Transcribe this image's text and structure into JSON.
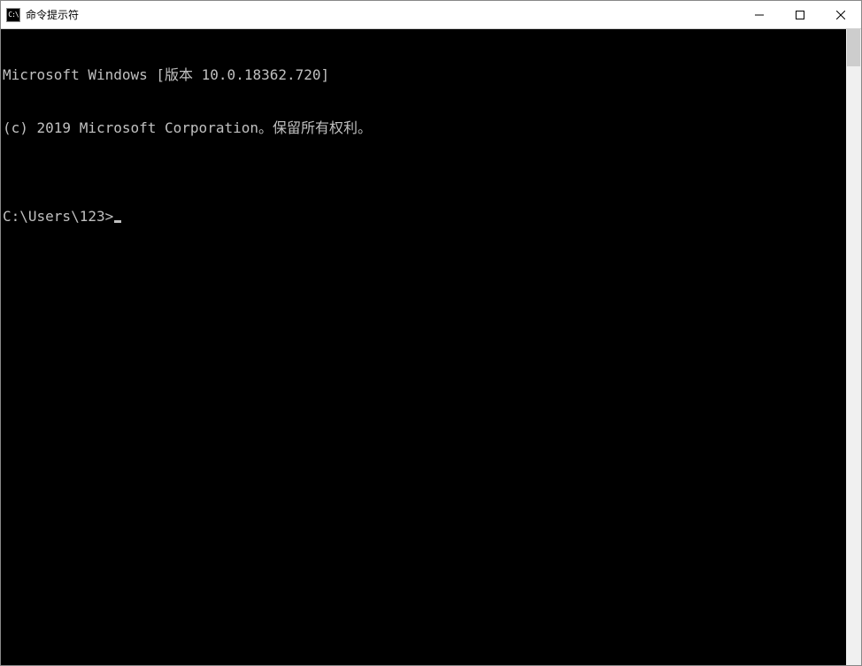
{
  "window": {
    "title": "命令提示符",
    "icon_label": "C:\\"
  },
  "console": {
    "line1": "Microsoft Windows [版本 10.0.18362.720]",
    "line2": "(c) 2019 Microsoft Corporation。保留所有权利。",
    "blank": "",
    "prompt": "C:\\Users\\123>"
  }
}
